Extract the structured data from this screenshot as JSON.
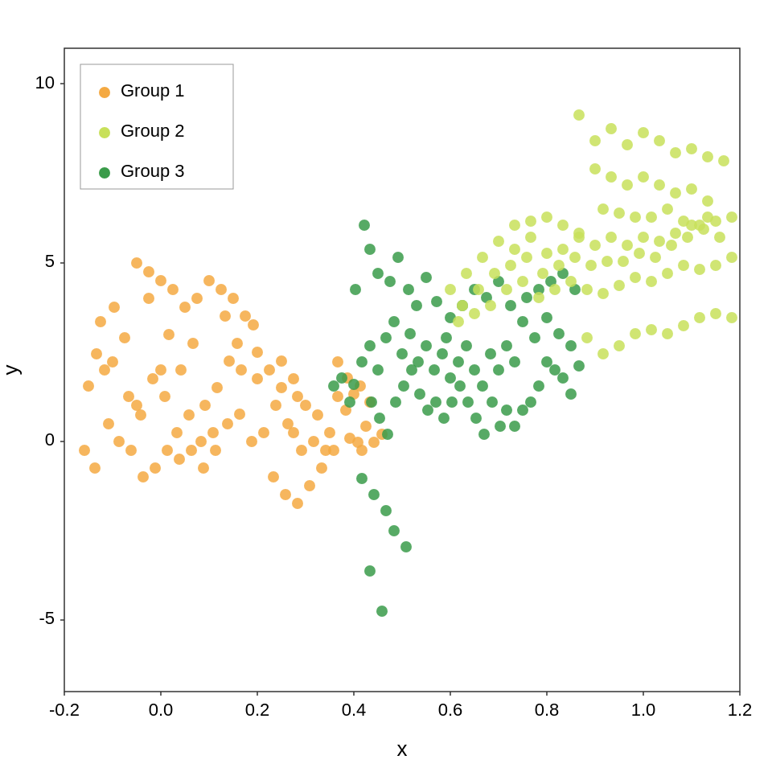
{
  "chart": {
    "title": "",
    "x_label": "x",
    "y_label": "y",
    "x_min": -0.2,
    "x_max": 1.2,
    "y_min": -7,
    "y_max": 11,
    "x_ticks": [
      -0.2,
      0.0,
      0.2,
      0.4,
      0.6,
      0.8,
      1.0,
      1.2
    ],
    "y_ticks": [
      -5,
      0,
      5,
      10
    ],
    "legend": [
      {
        "label": "Group 1",
        "color": "#F4A942"
      },
      {
        "label": "Group 2",
        "color": "#BFDF5A"
      },
      {
        "label": "Group 3",
        "color": "#2E8B44"
      }
    ],
    "groups": {
      "group1_color": "#F4A942",
      "group2_color": "#C8E05A",
      "group3_color": "#2E8B44"
    }
  }
}
